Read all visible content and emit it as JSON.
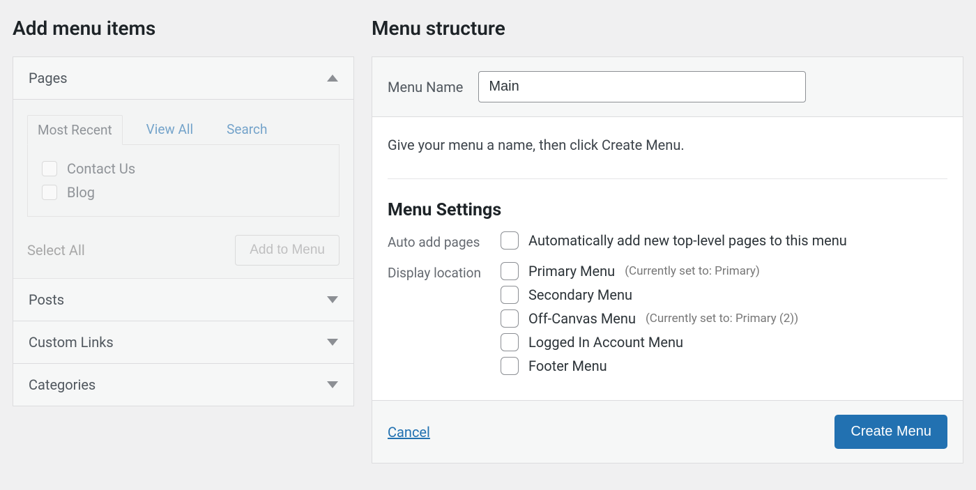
{
  "left": {
    "heading": "Add menu items",
    "pages": {
      "title": "Pages",
      "tabs": {
        "recent": "Most Recent",
        "viewall": "View All",
        "search": "Search"
      },
      "items": [
        "Contact Us",
        "Blog"
      ],
      "select_all": "Select All",
      "add_button": "Add to Menu"
    },
    "posts_title": "Posts",
    "custom_links_title": "Custom Links",
    "categories_title": "Categories"
  },
  "right": {
    "heading": "Menu structure",
    "menu_name_label": "Menu Name",
    "menu_name_value": "Main",
    "instructions": "Give your menu a name, then click Create Menu.",
    "menu_settings_heading": "Menu Settings",
    "auto_add_label": "Auto add pages",
    "auto_add_text": "Automatically add new top-level pages to this menu",
    "display_loc_label": "Display location",
    "locations": {
      "primary": {
        "label": "Primary Menu",
        "note": "(Currently set to: Primary)"
      },
      "secondary": {
        "label": "Secondary Menu"
      },
      "offcanvas": {
        "label": "Off-Canvas Menu",
        "note": "(Currently set to: Primary (2))"
      },
      "loggedin": {
        "label": "Logged In Account Menu"
      },
      "footer": {
        "label": "Footer Menu"
      }
    },
    "cancel": "Cancel",
    "create_button": "Create Menu"
  }
}
